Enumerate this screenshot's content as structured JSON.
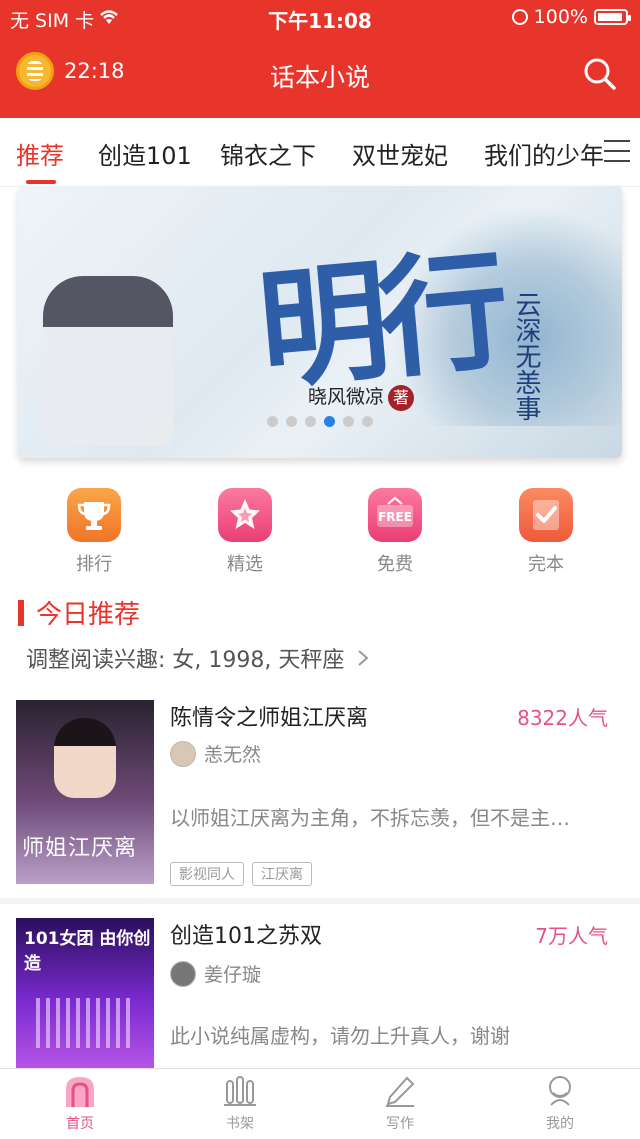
{
  "status_bar": {
    "carrier": "无 SIM 卡",
    "time": "下午11:08",
    "battery": "100%"
  },
  "nav": {
    "clock_time": "22:18",
    "title": "话本小说"
  },
  "tabs": [
    {
      "label": "推荐"
    },
    {
      "label": "创造101"
    },
    {
      "label": "锦衣之下"
    },
    {
      "label": "双世宠妃"
    },
    {
      "label": "我们的少年"
    }
  ],
  "banner": {
    "title_art": "明行",
    "author": "晓风微凉",
    "author_badge": "著",
    "side_text": "云深无恙事",
    "page_count": 6,
    "active_page": 5
  },
  "categories": [
    {
      "label": "排行",
      "icon": "trophy-icon",
      "color": "#f7923a"
    },
    {
      "label": "精选",
      "icon": "star-icon",
      "color": "#f25f8a"
    },
    {
      "label": "免费",
      "icon": "free-tag-icon",
      "color": "#f25f8a",
      "glyph": "FREE"
    },
    {
      "label": "完本",
      "icon": "check-book-icon",
      "color": "#f47a5a"
    }
  ],
  "section": {
    "title": "今日推荐",
    "preference": "调整阅读兴趣: 女, 1998, 天秤座"
  },
  "books": [
    {
      "title": "陈情令之师姐江厌离",
      "popularity": "8322人气",
      "author": "恙无然",
      "description": "以师姐江厌离为主角，不拆忘羡，但不是主…",
      "tags": [
        "影视同人",
        "江厌离"
      ],
      "cover_text": "师姐江厌离"
    },
    {
      "title": "创造101之苏双",
      "popularity": "7万人气",
      "author": "姜仔璇",
      "description": "此小说纯属虚构，请勿上升真人，谢谢",
      "tags": [],
      "cover_text": "101女团 由你创造"
    }
  ],
  "tabbar": [
    {
      "label": "首页",
      "icon": "home-icon",
      "active": true
    },
    {
      "label": "书架",
      "icon": "bookshelf-icon"
    },
    {
      "label": "写作",
      "icon": "pen-icon"
    },
    {
      "label": "我的",
      "icon": "profile-icon"
    }
  ]
}
